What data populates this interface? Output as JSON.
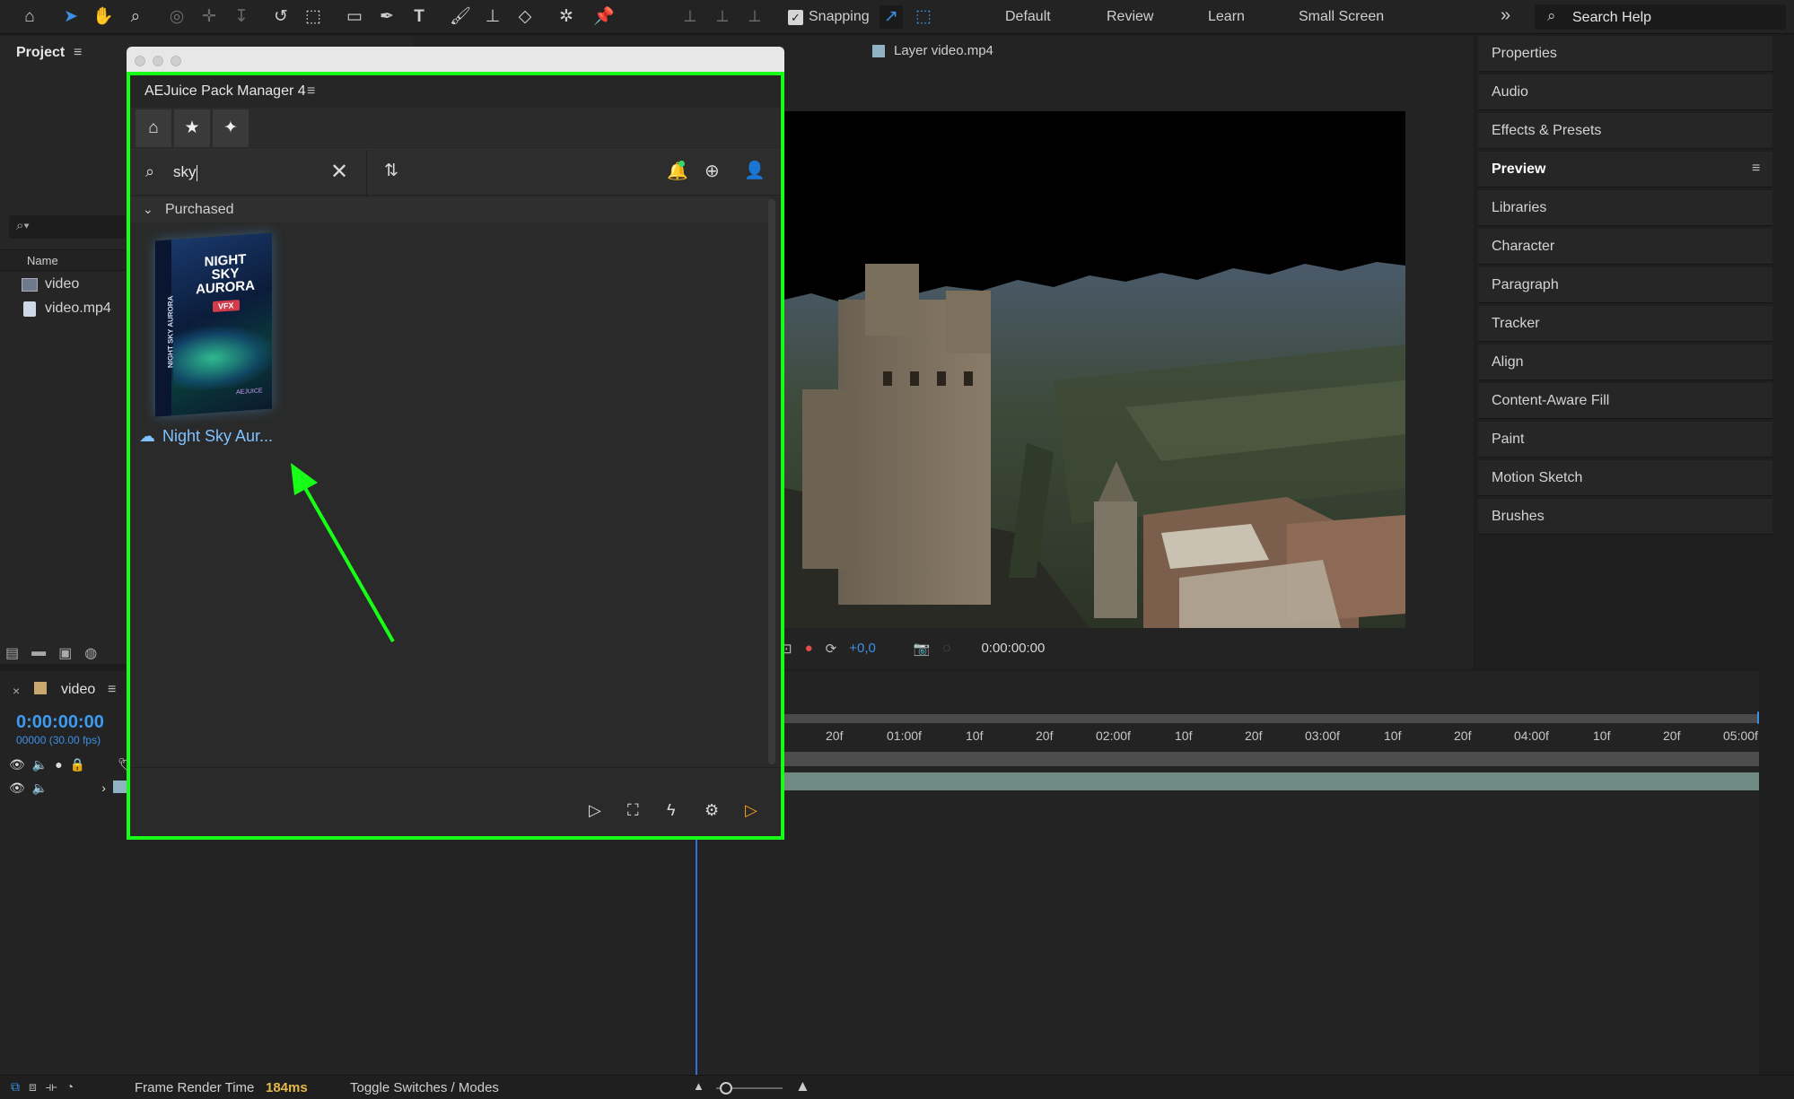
{
  "toolbar": {
    "snapping_label": "Snapping",
    "workspaces": [
      "Default",
      "Review",
      "Learn",
      "Small Screen"
    ],
    "search_placeholder": "Search Help"
  },
  "project": {
    "title": "Project",
    "column_name": "Name",
    "items": [
      {
        "label": "video",
        "icon": "composition-icon"
      },
      {
        "label": "video.mp4",
        "icon": "footage-icon"
      }
    ]
  },
  "viewer": {
    "layer_tab": "Layer video.mp4",
    "exposure": "+0,0",
    "timecode": "0:00:00:00"
  },
  "timeline": {
    "comp_name": "video",
    "current_time": "0:00:00:00",
    "frame_info": "00000 (30.00 fps)",
    "ruler": [
      "20f",
      "01:00f",
      "10f",
      "20f",
      "02:00f",
      "10f",
      "20f",
      "03:00f",
      "10f",
      "20f",
      "04:00f",
      "10f",
      "20f",
      "05:00f"
    ]
  },
  "right_panel": {
    "items": [
      "Properties",
      "Audio",
      "Effects & Presets",
      "Preview",
      "Libraries",
      "Character",
      "Paragraph",
      "Tracker",
      "Align",
      "Content-Aware Fill",
      "Paint",
      "Motion Sketch",
      "Brushes"
    ],
    "selected": "Preview"
  },
  "pack_manager": {
    "title": "AEJuice Pack Manager 4",
    "search_value": "sky",
    "section_label": "Purchased",
    "product": {
      "name": "Night Sky Aur...",
      "box_line1": "NIGHT",
      "box_line2": "SKY",
      "box_line3": "AURORA",
      "box_badge": "VFX",
      "box_side": "NIGHT SKY AURORA",
      "box_brand": "AEJUICE"
    }
  },
  "status_bar": {
    "render_label": "Frame Render Time",
    "render_value": "184ms",
    "toggle_label": "Toggle Switches / Modes"
  },
  "colors": {
    "highlight_border": "#17ff17",
    "accent_blue": "#3d8fe6",
    "render_value": "#e6b84a"
  }
}
